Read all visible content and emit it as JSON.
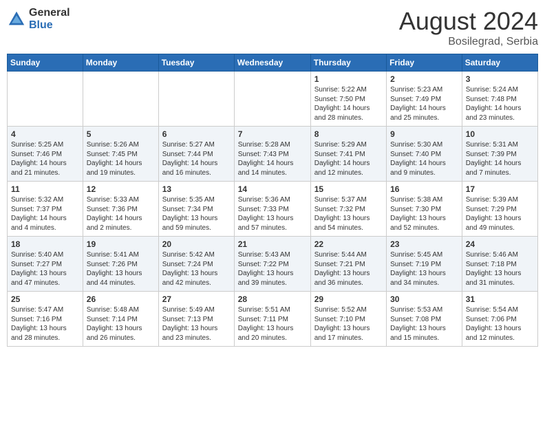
{
  "logo": {
    "general": "General",
    "blue": "Blue"
  },
  "title": "August 2024",
  "location": "Bosilegrad, Serbia",
  "days_header": [
    "Sunday",
    "Monday",
    "Tuesday",
    "Wednesday",
    "Thursday",
    "Friday",
    "Saturday"
  ],
  "weeks": [
    [
      {
        "day": "",
        "info": ""
      },
      {
        "day": "",
        "info": ""
      },
      {
        "day": "",
        "info": ""
      },
      {
        "day": "",
        "info": ""
      },
      {
        "day": "1",
        "info": "Sunrise: 5:22 AM\nSunset: 7:50 PM\nDaylight: 14 hours\nand 28 minutes."
      },
      {
        "day": "2",
        "info": "Sunrise: 5:23 AM\nSunset: 7:49 PM\nDaylight: 14 hours\nand 25 minutes."
      },
      {
        "day": "3",
        "info": "Sunrise: 5:24 AM\nSunset: 7:48 PM\nDaylight: 14 hours\nand 23 minutes."
      }
    ],
    [
      {
        "day": "4",
        "info": "Sunrise: 5:25 AM\nSunset: 7:46 PM\nDaylight: 14 hours\nand 21 minutes."
      },
      {
        "day": "5",
        "info": "Sunrise: 5:26 AM\nSunset: 7:45 PM\nDaylight: 14 hours\nand 19 minutes."
      },
      {
        "day": "6",
        "info": "Sunrise: 5:27 AM\nSunset: 7:44 PM\nDaylight: 14 hours\nand 16 minutes."
      },
      {
        "day": "7",
        "info": "Sunrise: 5:28 AM\nSunset: 7:43 PM\nDaylight: 14 hours\nand 14 minutes."
      },
      {
        "day": "8",
        "info": "Sunrise: 5:29 AM\nSunset: 7:41 PM\nDaylight: 14 hours\nand 12 minutes."
      },
      {
        "day": "9",
        "info": "Sunrise: 5:30 AM\nSunset: 7:40 PM\nDaylight: 14 hours\nand 9 minutes."
      },
      {
        "day": "10",
        "info": "Sunrise: 5:31 AM\nSunset: 7:39 PM\nDaylight: 14 hours\nand 7 minutes."
      }
    ],
    [
      {
        "day": "11",
        "info": "Sunrise: 5:32 AM\nSunset: 7:37 PM\nDaylight: 14 hours\nand 4 minutes."
      },
      {
        "day": "12",
        "info": "Sunrise: 5:33 AM\nSunset: 7:36 PM\nDaylight: 14 hours\nand 2 minutes."
      },
      {
        "day": "13",
        "info": "Sunrise: 5:35 AM\nSunset: 7:34 PM\nDaylight: 13 hours\nand 59 minutes."
      },
      {
        "day": "14",
        "info": "Sunrise: 5:36 AM\nSunset: 7:33 PM\nDaylight: 13 hours\nand 57 minutes."
      },
      {
        "day": "15",
        "info": "Sunrise: 5:37 AM\nSunset: 7:32 PM\nDaylight: 13 hours\nand 54 minutes."
      },
      {
        "day": "16",
        "info": "Sunrise: 5:38 AM\nSunset: 7:30 PM\nDaylight: 13 hours\nand 52 minutes."
      },
      {
        "day": "17",
        "info": "Sunrise: 5:39 AM\nSunset: 7:29 PM\nDaylight: 13 hours\nand 49 minutes."
      }
    ],
    [
      {
        "day": "18",
        "info": "Sunrise: 5:40 AM\nSunset: 7:27 PM\nDaylight: 13 hours\nand 47 minutes."
      },
      {
        "day": "19",
        "info": "Sunrise: 5:41 AM\nSunset: 7:26 PM\nDaylight: 13 hours\nand 44 minutes."
      },
      {
        "day": "20",
        "info": "Sunrise: 5:42 AM\nSunset: 7:24 PM\nDaylight: 13 hours\nand 42 minutes."
      },
      {
        "day": "21",
        "info": "Sunrise: 5:43 AM\nSunset: 7:22 PM\nDaylight: 13 hours\nand 39 minutes."
      },
      {
        "day": "22",
        "info": "Sunrise: 5:44 AM\nSunset: 7:21 PM\nDaylight: 13 hours\nand 36 minutes."
      },
      {
        "day": "23",
        "info": "Sunrise: 5:45 AM\nSunset: 7:19 PM\nDaylight: 13 hours\nand 34 minutes."
      },
      {
        "day": "24",
        "info": "Sunrise: 5:46 AM\nSunset: 7:18 PM\nDaylight: 13 hours\nand 31 minutes."
      }
    ],
    [
      {
        "day": "25",
        "info": "Sunrise: 5:47 AM\nSunset: 7:16 PM\nDaylight: 13 hours\nand 28 minutes."
      },
      {
        "day": "26",
        "info": "Sunrise: 5:48 AM\nSunset: 7:14 PM\nDaylight: 13 hours\nand 26 minutes."
      },
      {
        "day": "27",
        "info": "Sunrise: 5:49 AM\nSunset: 7:13 PM\nDaylight: 13 hours\nand 23 minutes."
      },
      {
        "day": "28",
        "info": "Sunrise: 5:51 AM\nSunset: 7:11 PM\nDaylight: 13 hours\nand 20 minutes."
      },
      {
        "day": "29",
        "info": "Sunrise: 5:52 AM\nSunset: 7:10 PM\nDaylight: 13 hours\nand 17 minutes."
      },
      {
        "day": "30",
        "info": "Sunrise: 5:53 AM\nSunset: 7:08 PM\nDaylight: 13 hours\nand 15 minutes."
      },
      {
        "day": "31",
        "info": "Sunrise: 5:54 AM\nSunset: 7:06 PM\nDaylight: 13 hours\nand 12 minutes."
      }
    ]
  ]
}
